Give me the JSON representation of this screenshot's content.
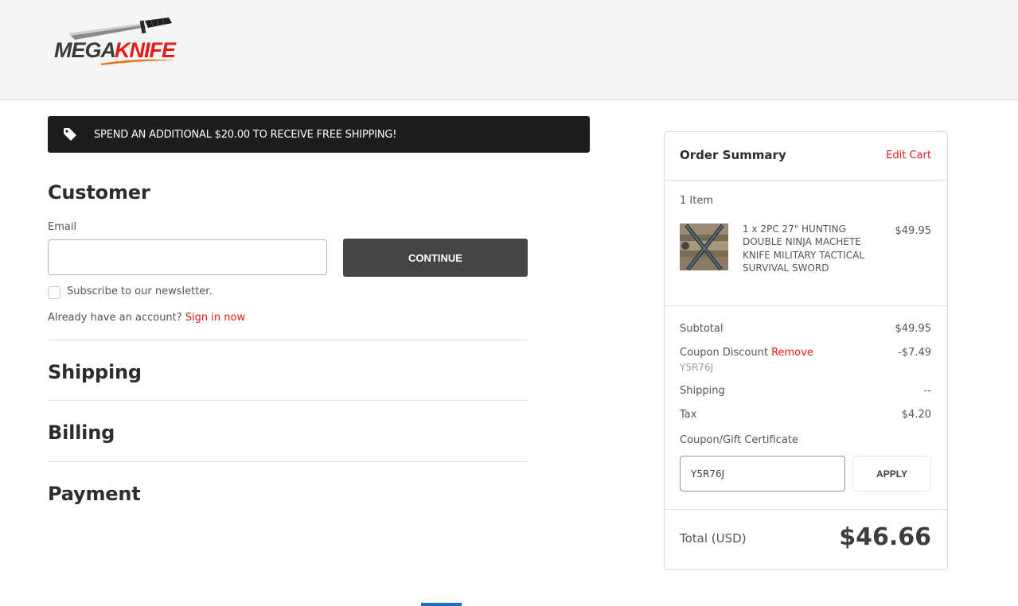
{
  "brand": {
    "logo_text": "MEGAKNIFE",
    "logo_part1": "MEGA",
    "logo_part2": "KNIFE"
  },
  "banner": {
    "text": "SPEND AN ADDITIONAL $20.00 TO RECEIVE FREE SHIPPING!",
    "icon": "tag-icon"
  },
  "customer": {
    "title": "Customer",
    "email_label": "Email",
    "email_value": "",
    "continue_label": "CONTINUE",
    "newsletter_label": "Subscribe to our newsletter.",
    "account_prompt": "Already have an account?",
    "sign_in_label": "Sign in now"
  },
  "sections": {
    "shipping": "Shipping",
    "billing": "Billing",
    "payment": "Payment"
  },
  "summary": {
    "title": "Order Summary",
    "edit_cart": "Edit Cart",
    "item_count": "1 Item",
    "item": {
      "name": "1 x 2PC 27\" HUNTING DOUBLE NINJA MACHETE KNIFE MILITARY TACTICAL SURVIVAL SWORD",
      "price": "$49.95"
    },
    "subtotal_label": "Subtotal",
    "subtotal_value": "$49.95",
    "coupon_label": "Coupon Discount",
    "coupon_remove": "Remove",
    "coupon_value": "-$7.49",
    "coupon_code": "Y5R76J",
    "shipping_label": "Shipping",
    "shipping_value": "--",
    "tax_label": "Tax",
    "tax_value": "$4.20",
    "gift_label": "Coupon/Gift Certificate",
    "gift_input_value": "Y5R76J",
    "apply_label": "APPLY",
    "total_label": "Total (USD)",
    "total_value": "$46.66"
  },
  "colors": {
    "accent": "#e51a1a",
    "dark_button": "#454545",
    "banner_bg": "#1d1d1d",
    "progress": "#1a6fc4"
  }
}
